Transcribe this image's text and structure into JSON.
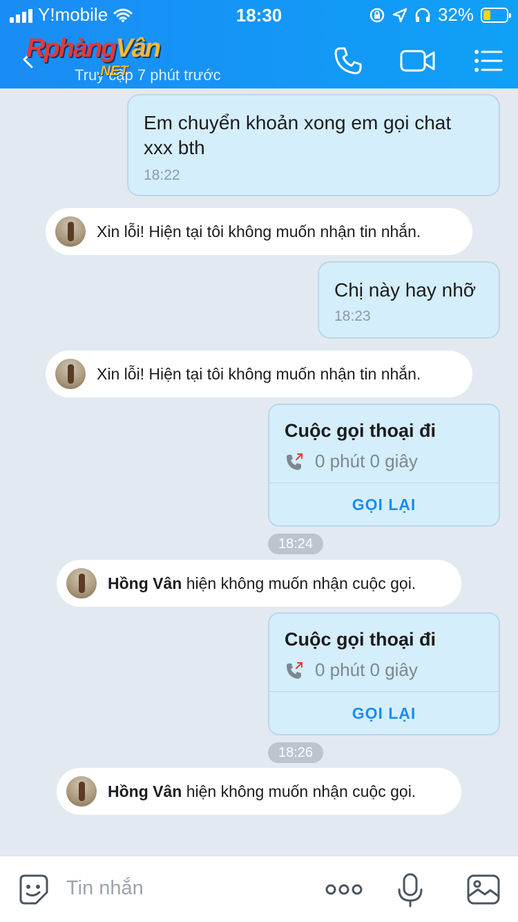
{
  "status_bar": {
    "carrier": "Y!mobile",
    "time": "18:30",
    "battery": "32%"
  },
  "header": {
    "logo_main": "Rphàng",
    "logo_accent": "Vân",
    "logo_suffix": ".NET",
    "subtitle": "Truy cập 7 phút trước",
    "icons": [
      "back-icon",
      "phone-icon",
      "video-icon",
      "menu-icon"
    ],
    "color": "#1a8cf5"
  },
  "messages": {
    "m1": {
      "text": "Em chuyển khoản xong em gọi chat xxx bth",
      "time": "18:22"
    },
    "s1": {
      "text": "Xin lỗi! Hiện tại tôi không muốn nhận tin nhắn."
    },
    "m2": {
      "text": "Chị này hay nhỡ",
      "time": "18:23"
    },
    "s2": {
      "text": "Xin lỗi! Hiện tại tôi không muốn nhận tin nhắn."
    },
    "c1": {
      "title": "Cuộc gọi thoại đi",
      "duration": "0 phút 0 giây",
      "action": "GỌI LẠI",
      "stamp": "18:24"
    },
    "s3": {
      "name": "Hồng Vân",
      "text": " hiện không muốn nhận cuộc gọi."
    },
    "c2": {
      "title": "Cuộc gọi thoại đi",
      "duration": "0 phút 0 giây",
      "action": "GỌI LẠI",
      "stamp": "18:26"
    },
    "s4": {
      "name": "Hồng Vân",
      "text": " hiện không muốn nhận cuộc gọi."
    }
  },
  "input": {
    "placeholder": "Tin nhắn",
    "icons": [
      "sticker-icon",
      "more-icon",
      "microphone-icon",
      "image-icon"
    ]
  }
}
